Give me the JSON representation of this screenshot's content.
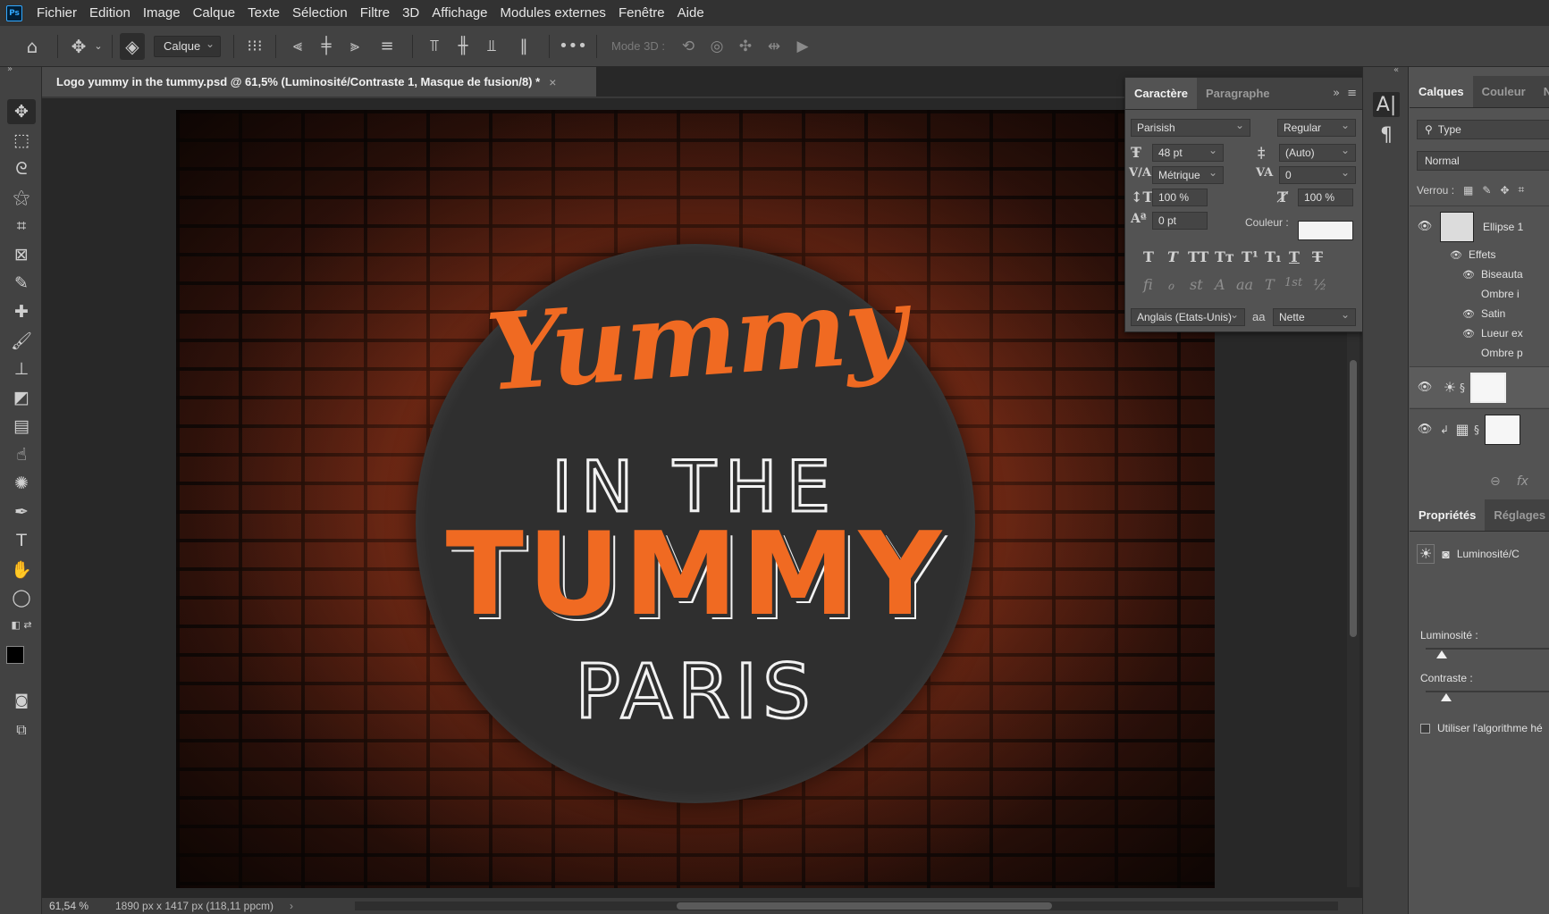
{
  "menu": [
    "Fichier",
    "Edition",
    "Image",
    "Calque",
    "Texte",
    "Sélection",
    "Filtre",
    "3D",
    "Affichage",
    "Modules externes",
    "Fenêtre",
    "Aide"
  ],
  "app_logo": "Ps",
  "options_bar": {
    "layer_select": "Calque",
    "mode3d_label": "Mode 3D :"
  },
  "document": {
    "tab_title": "Logo yummy in the tummy.psd @ 61,5% (Luminosité/Contraste 1, Masque de fusion/8) *",
    "close_glyph": "×",
    "zoom": "61,54 %",
    "size": "1890 px x 1417 px (118,11 ppcm)"
  },
  "artwork": {
    "line1": "Yummy",
    "line2": "IN THE",
    "line3": "TUMMY",
    "line4": "PARIS",
    "orange": "#f06a22",
    "badge_color": "#2f2f2f"
  },
  "character_panel": {
    "tabs": [
      "Caractère",
      "Paragraphe"
    ],
    "font_family": "Parisish",
    "font_style": "Regular",
    "font_size": "48 pt",
    "leading": "(Auto)",
    "kerning": "Métrique",
    "tracking": "0",
    "vertical_scale": "100 %",
    "horizontal_scale": "100 %",
    "baseline_shift": "0 pt",
    "color_label": "Couleur :",
    "color_value": "#f4f4f4",
    "language": "Anglais (Etats-Unis)",
    "antialias_icon": "aa",
    "antialias": "Nette",
    "style_buttons": [
      "T",
      "T",
      "TT",
      "Tт",
      "T¹",
      "T₁",
      "T",
      "T"
    ],
    "glyph_buttons": [
      "ﬁ",
      "ℴ",
      "st",
      "A",
      "aa",
      "T",
      "1st",
      "½"
    ]
  },
  "layers_panel": {
    "tabs": [
      "Calques",
      "Couleur",
      "N"
    ],
    "filter": "Type",
    "blend_mode": "Normal",
    "lock_label": "Verrou :",
    "layers": [
      {
        "name": "Ellipse 1"
      },
      {
        "name": ""
      },
      {
        "name": ""
      }
    ],
    "effects_label": "Effets",
    "effects": [
      "Biseauta",
      "Ombre i",
      "Satin",
      "Lueur ex",
      "Ombre p"
    ],
    "footer_fx": "fx"
  },
  "properties_panel": {
    "tabs": [
      "Propriétés",
      "Réglages"
    ],
    "adjustment_name": "Luminosité/C",
    "brightness_label": "Luminosité :",
    "brightness_value": 0.12,
    "contrast_label": "Contraste :",
    "contrast_value": 0.15,
    "algo_label": "Utiliser l'algorithme hé"
  },
  "icons": {
    "home": "home-icon",
    "move": "move-icon",
    "more": "more-icon"
  }
}
